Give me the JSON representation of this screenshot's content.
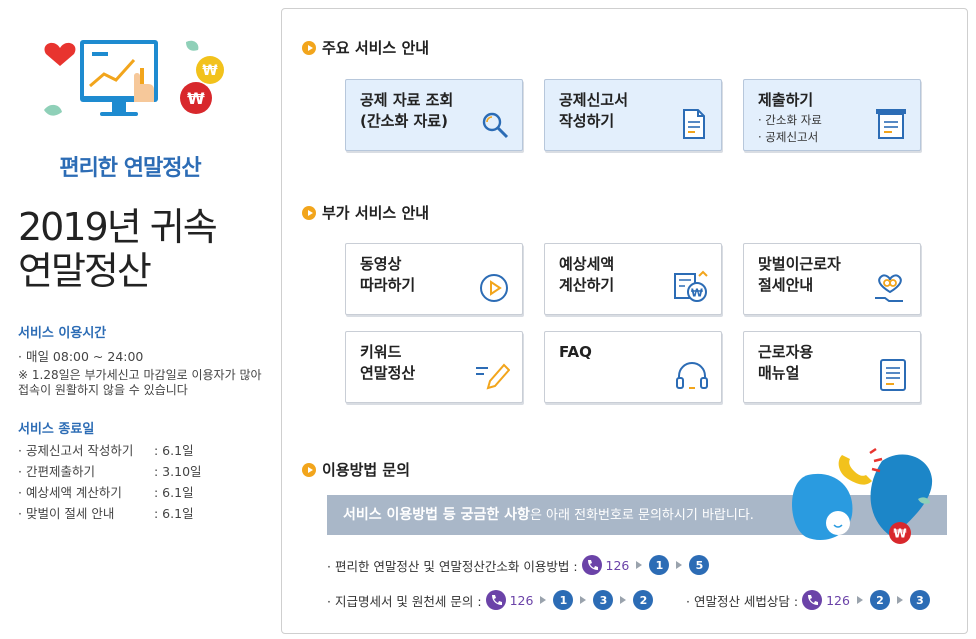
{
  "left": {
    "hero_title": "편리한 연말정산",
    "big_title_line1": "2019년 귀속",
    "big_title_line2": "연말정산",
    "service_hours": {
      "heading": "서비스 이용시간",
      "line": "· 매일 08:00 ~ 24:00",
      "note": "※ 1.28일은 부가세신고 마감일로 이용자가 많아 접속이 원활하지 않을 수 있습니다"
    },
    "service_end": {
      "heading": "서비스 종료일",
      "items": [
        {
          "label": "· 공제신고서 작성하기",
          "value": ": 6.1일"
        },
        {
          "label": "· 간편제출하기",
          "value": ": 3.10일"
        },
        {
          "label": "· 예상세액 계산하기",
          "value": ": 6.1일"
        },
        {
          "label": "· 맞벌이 절세 안내",
          "value": ": 6.1일"
        }
      ]
    }
  },
  "main_services": {
    "heading": "주요 서비스 안내",
    "cards": [
      {
        "title": "공제 자료 조회\n(간소화 자료)",
        "icon": "magnifier-icon"
      },
      {
        "title": "공제신고서\n작성하기",
        "icon": "document-pen-icon"
      },
      {
        "title": "제출하기",
        "sub": [
          "· 간소화 자료",
          "· 공제신고서"
        ],
        "icon": "tray-submit-icon"
      }
    ]
  },
  "extra_services": {
    "heading": "부가 서비스 안내",
    "cards": [
      {
        "title": "동영상\n따라하기",
        "icon": "play-icon"
      },
      {
        "title": "예상세액\n계산하기",
        "icon": "calculator-won-icon"
      },
      {
        "title": "맞벌이근로자\n절세안내",
        "icon": "heart-hand-icon"
      },
      {
        "title": "키워드\n연말정산",
        "icon": "pen-lines-icon"
      },
      {
        "title": "FAQ",
        "icon": "headset-icon"
      },
      {
        "title": "근로자용\n매뉴얼",
        "icon": "manual-icon"
      }
    ]
  },
  "inquiry": {
    "heading": "이용방법 문의",
    "banner_bold": "서비스 이용방법 등 궁금한 사항",
    "banner_rest": "은 아래 전화번호로 문의하시기 바랍니다.",
    "lines": [
      {
        "label": "· 편리한 연말정산 및 연말정산간소화 이용방법 :",
        "number": "126",
        "steps": [
          "1",
          "5"
        ]
      },
      {
        "label": "· 지급명세서 및 원천세 문의 :",
        "number": "126",
        "steps": [
          "1",
          "3",
          "2"
        ]
      },
      {
        "label": "· 연말정산 세법상담 :",
        "number": "126",
        "steps": [
          "2",
          "3"
        ]
      }
    ]
  },
  "colors": {
    "accent": "#2c6cb5",
    "bullet": "#f2a51c",
    "phone": "#6b43a8",
    "card_main_bg": "#e3effc"
  }
}
